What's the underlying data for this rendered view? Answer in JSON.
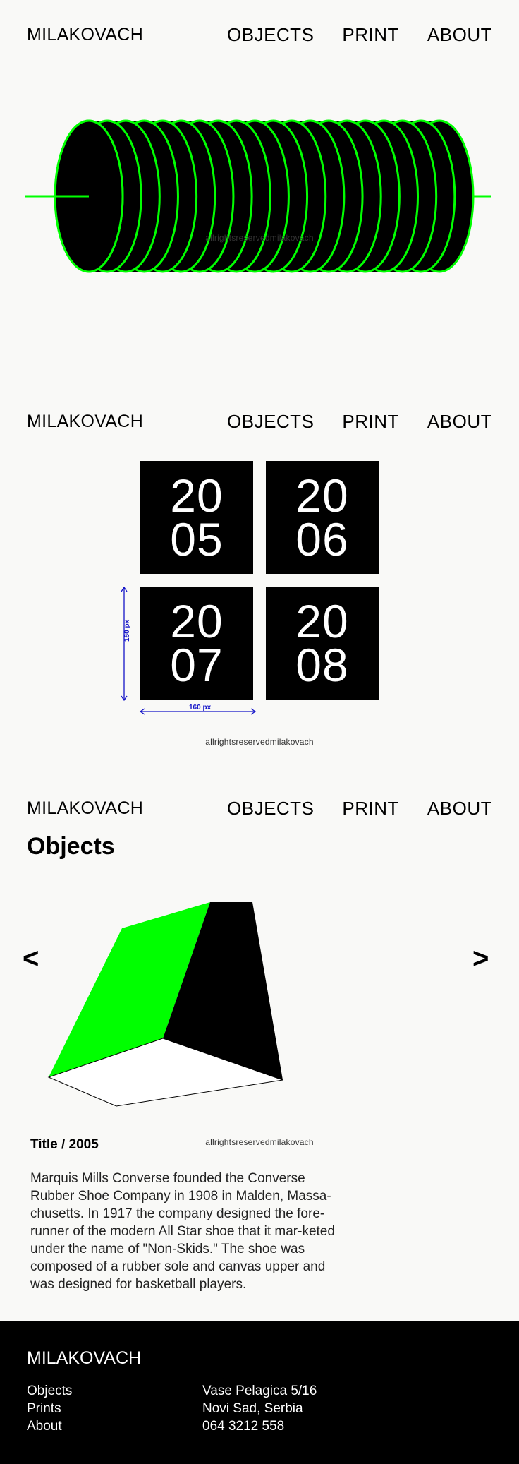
{
  "brand": "MILAKOVACH",
  "nav": {
    "objects": "OBJECTS",
    "print": "PRINT",
    "about": "ABOUT"
  },
  "copyright": "allrightsreservedmilakovach",
  "colors": {
    "accent": "#00ff00",
    "ink": "#000000",
    "background": "#f9f9f7",
    "dimension": "#1515c8"
  },
  "years": [
    {
      "top": "20",
      "bottom": "05"
    },
    {
      "top": "20",
      "bottom": "06"
    },
    {
      "top": "20",
      "bottom": "07"
    },
    {
      "top": "20",
      "bottom": "08"
    }
  ],
  "dimensions": {
    "width_label": "160 px",
    "height_label": "160 px"
  },
  "objects_page": {
    "title": "Objects",
    "prev": "<",
    "next": ">",
    "item_title": "Title / 2005",
    "description": "Marquis Mills Converse founded the Converse Rubber Shoe Company in 1908 in Malden, Massa-chusetts. In 1917 the company designed the fore-runner of the modern All Star shoe that it mar-keted under the name of \"Non-Skids.\" The shoe was composed of a rubber sole and canvas upper and was designed for basketball players."
  },
  "footer": {
    "brand": "MILAKOVACH",
    "links": [
      "Objects",
      "Prints",
      "About"
    ],
    "address": [
      "Vase Pelagica 5/16",
      "Novi Sad, Serbia",
      "064 3212 558"
    ]
  }
}
